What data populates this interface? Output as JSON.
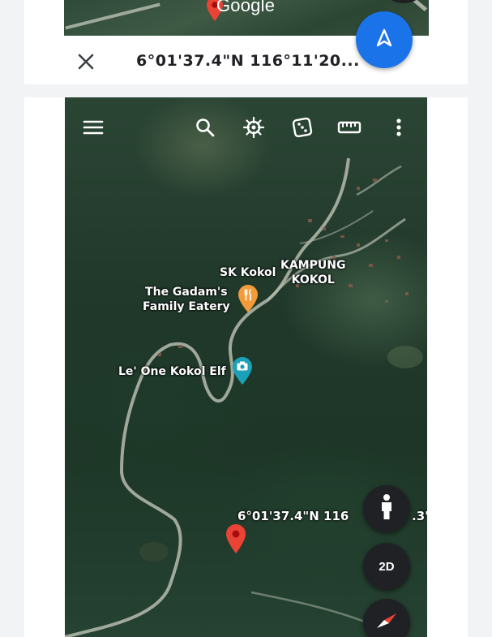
{
  "top_card": {
    "logo_text": "Google",
    "coordinates_text": "6°01'37.4\"N 116°11'20...",
    "icons": {
      "close": "close-icon",
      "navigate": "navigation-arrow-icon",
      "pin": "map-pin-icon"
    },
    "colors": {
      "navigate_button": "#1a73e8",
      "pin": "#ea4335"
    }
  },
  "map": {
    "toolbar_icons": [
      "menu-icon",
      "search-icon",
      "voyager-helm-icon",
      "dice-icon",
      "ruler-icon",
      "more-vert-icon"
    ],
    "labels": {
      "school": "SK Kokol",
      "village_line1": "KAMPUNG",
      "village_line2": "KOKOL",
      "eatery_line1": "The Gadam's",
      "eatery_line2": "Family Eatery",
      "photo_spot": "Le' One Kokol Elf",
      "pin_coordinates_left": "6°01'37.4\"N 116",
      "pin_coordinates_right": ".3\""
    },
    "buttons": {
      "street_view": "pegman-icon",
      "view_mode_label": "2D",
      "compass": "compass-icon"
    },
    "colors": {
      "eatery_marker": "#f29b38",
      "photo_marker": "#1aa0b8",
      "pin": "#ea4335"
    }
  }
}
